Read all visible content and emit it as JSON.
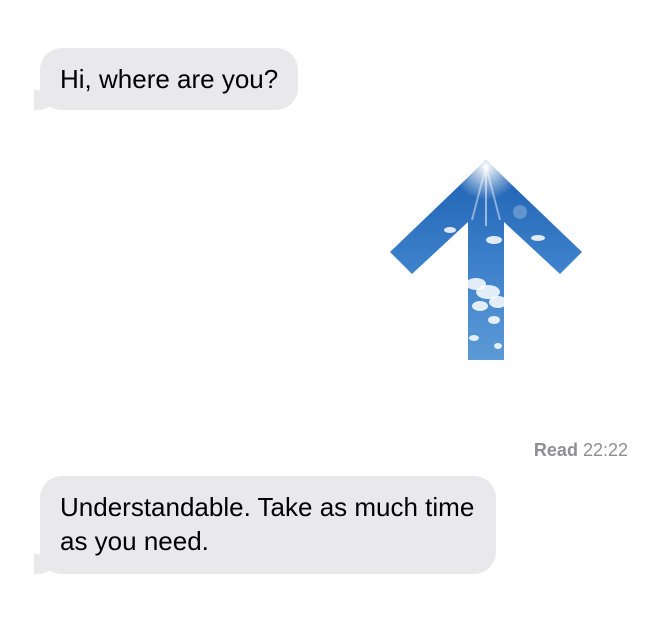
{
  "conversation": {
    "messages": [
      {
        "direction": "incoming",
        "text": "Hi, where are you?"
      },
      {
        "direction": "incoming",
        "text": "Understandable. Take as much time as you need."
      }
    ],
    "read_receipt": {
      "label": "Read",
      "time": "22:22"
    }
  },
  "overlay": {
    "icon": "up-arrow-icon",
    "fill": "sky-with-clouds"
  },
  "colors": {
    "bubble_incoming": "#e9e9eb",
    "background": "#ffffff",
    "receipt_text": "#8e8e93",
    "sky_top": "#1c5fb0",
    "sky_bottom": "#5c9ad6"
  }
}
